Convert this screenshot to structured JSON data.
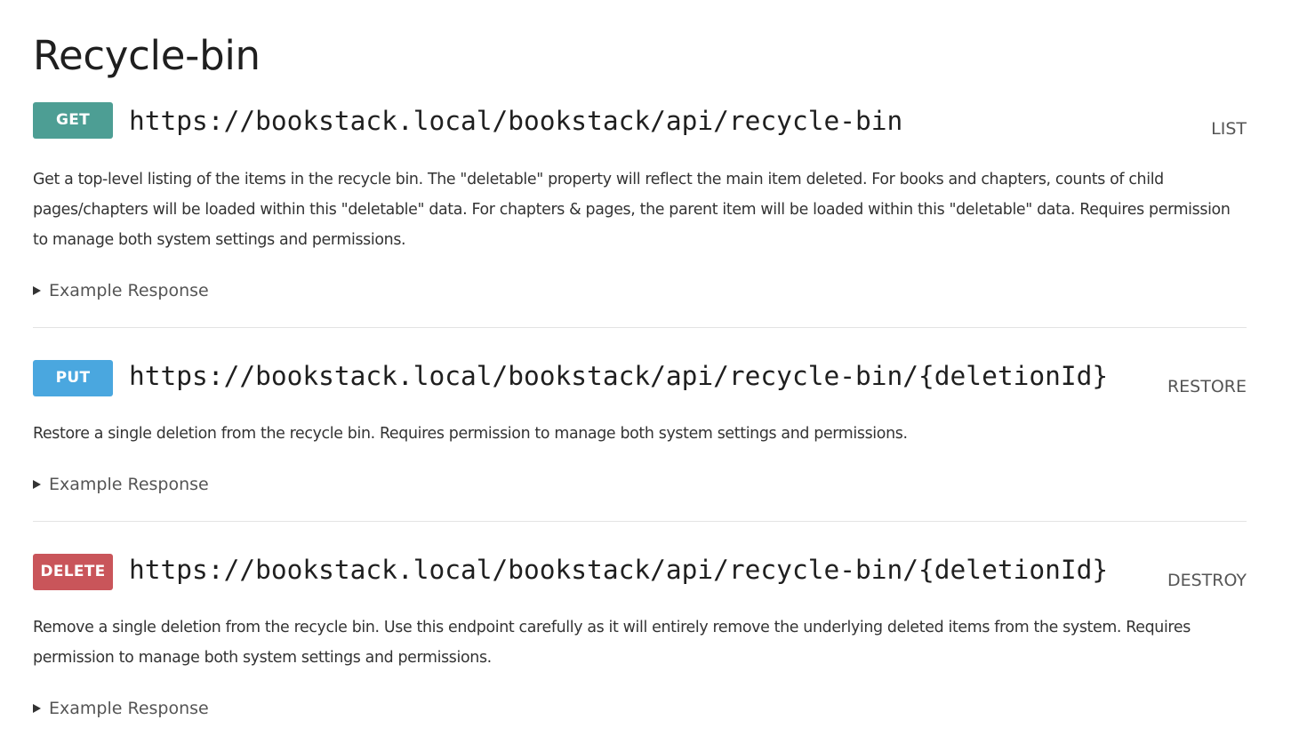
{
  "page": {
    "title": "Recycle-bin"
  },
  "endpoints": [
    {
      "method": "GET",
      "url": "https://bookstack.local/bookstack/api/recycle-bin",
      "name": "LIST",
      "description": "Get a top-level listing of the items in the recycle bin. The \"deletable\" property will reflect the main item deleted. For books and chapters, counts of child pages/chapters will be loaded within this \"deletable\" data. For chapters & pages, the parent item will be loaded within this \"deletable\" data. Requires permission to manage both system settings and permissions.",
      "example_label": "Example Response"
    },
    {
      "method": "PUT",
      "url": "https://bookstack.local/bookstack/api/recycle-bin/{deletionId}",
      "name": "RESTORE",
      "description": "Restore a single deletion from the recycle bin. Requires permission to manage both system settings and permissions.",
      "example_label": "Example Response"
    },
    {
      "method": "DELETE",
      "url": "https://bookstack.local/bookstack/api/recycle-bin/{deletionId}",
      "name": "DESTROY",
      "description": "Remove a single deletion from the recycle bin. Use this endpoint carefully as it will entirely remove the underlying deleted items from the system. Requires permission to manage both system settings and permissions.",
      "example_label": "Example Response"
    }
  ],
  "colors": {
    "get": "#4d9e94",
    "put": "#4aa7df",
    "delete": "#c9555a"
  }
}
